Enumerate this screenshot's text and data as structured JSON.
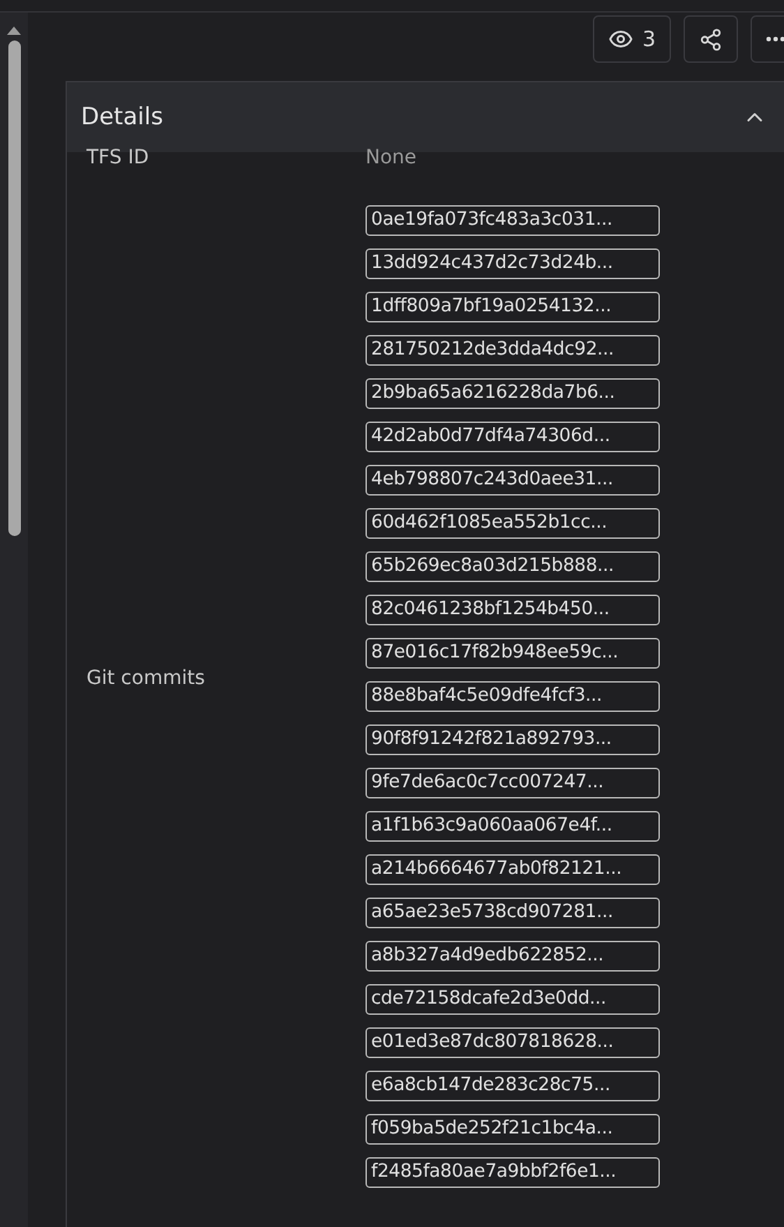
{
  "toolbar": {
    "watchers": "3"
  },
  "details": {
    "title": "Details",
    "expanded": true,
    "fields": [
      {
        "label": "TFS ID",
        "kind": "text",
        "value": "None"
      },
      {
        "label": "Git commits",
        "kind": "list",
        "values": [
          "0ae19fa073fc483a3c031...",
          "13dd924c437d2c73d24b...",
          "1dff809a7bf19a0254132...",
          "281750212de3dda4dc92...",
          "2b9ba65a6216228da7b6...",
          "42d2ab0d77df4a74306d...",
          "4eb798807c243d0aee31...",
          "60d462f1085ea552b1cc...",
          "65b269ec8a03d215b888...",
          "82c0461238bf1254b450...",
          "87e016c17f82b948ee59c...",
          "88e8baf4c5e09dfe4fcf3...",
          "90f8f91242f821a892793...",
          "9fe7de6ac0c7cc007247...",
          "a1f1b63c9a060aa067e4f...",
          "a214b6664677ab0f82121...",
          "a65ae23e5738cd907281...",
          "a8b327a4d9edb622852...",
          "cde72158dcafe2d3e0dd...",
          "e01ed3e87dc807818628...",
          "e6a8cb147de283c28c75...",
          "f059ba5de252f21c1bc4a...",
          "f2485fa80ae7a9bbf2f6e1..."
        ]
      }
    ]
  }
}
